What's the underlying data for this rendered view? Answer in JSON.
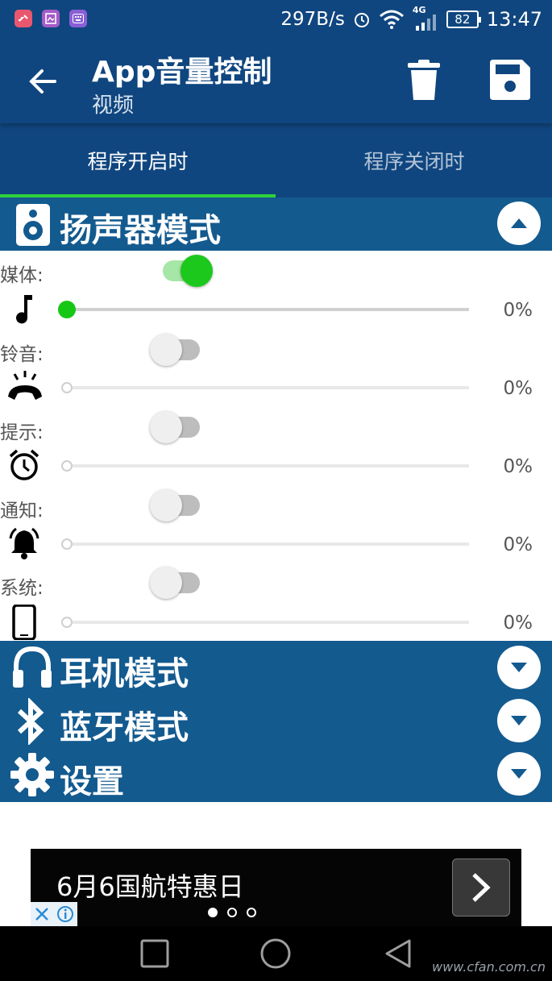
{
  "status_bar": {
    "net_speed": "297B/s",
    "network_type": "4G",
    "battery": "82",
    "time": "13:47",
    "icons": [
      "alarm-icon",
      "wifi-icon",
      "signal-icon",
      "battery-icon"
    ]
  },
  "app_bar": {
    "title": "App音量控制",
    "subtitle": "视频",
    "icons": [
      "back-arrow-icon",
      "trash-icon",
      "save-icon"
    ]
  },
  "tabs": [
    {
      "label": "程序开启时",
      "active": true
    },
    {
      "label": "程序关闭时",
      "active": false
    }
  ],
  "speaker_section": {
    "title": "扬声器模式",
    "icon": "speaker-icon",
    "expanded": true,
    "rows": [
      {
        "label": "媒体:",
        "enabled": true,
        "icon": "music-note-icon",
        "percent": "0%",
        "level": 0
      },
      {
        "label": "铃音:",
        "enabled": false,
        "icon": "ringing-phone-icon",
        "percent": "0%",
        "level": 0
      },
      {
        "label": "提示:",
        "enabled": false,
        "icon": "alarm-clock-icon",
        "percent": "0%",
        "level": 0
      },
      {
        "label": "通知:",
        "enabled": false,
        "icon": "bell-icon",
        "percent": "0%",
        "level": 0
      },
      {
        "label": "系统:",
        "enabled": false,
        "icon": "phone-device-icon",
        "percent": "0%",
        "level": 0
      }
    ]
  },
  "collapsed_sections": [
    {
      "title": "耳机模式",
      "icon": "headphones-icon"
    },
    {
      "title": "蓝牙模式",
      "icon": "bluetooth-icon"
    },
    {
      "title": "设置",
      "icon": "gear-icon"
    }
  ],
  "ad": {
    "text": "6月6国航特惠日",
    "page_count": 3,
    "current_page": 1
  },
  "watermark": "www.cfan.com.cn",
  "colors": {
    "primary": "#10467f",
    "section": "#135a8f",
    "accent": "#1cc81c",
    "tab_indicator": "#2fd23a"
  }
}
